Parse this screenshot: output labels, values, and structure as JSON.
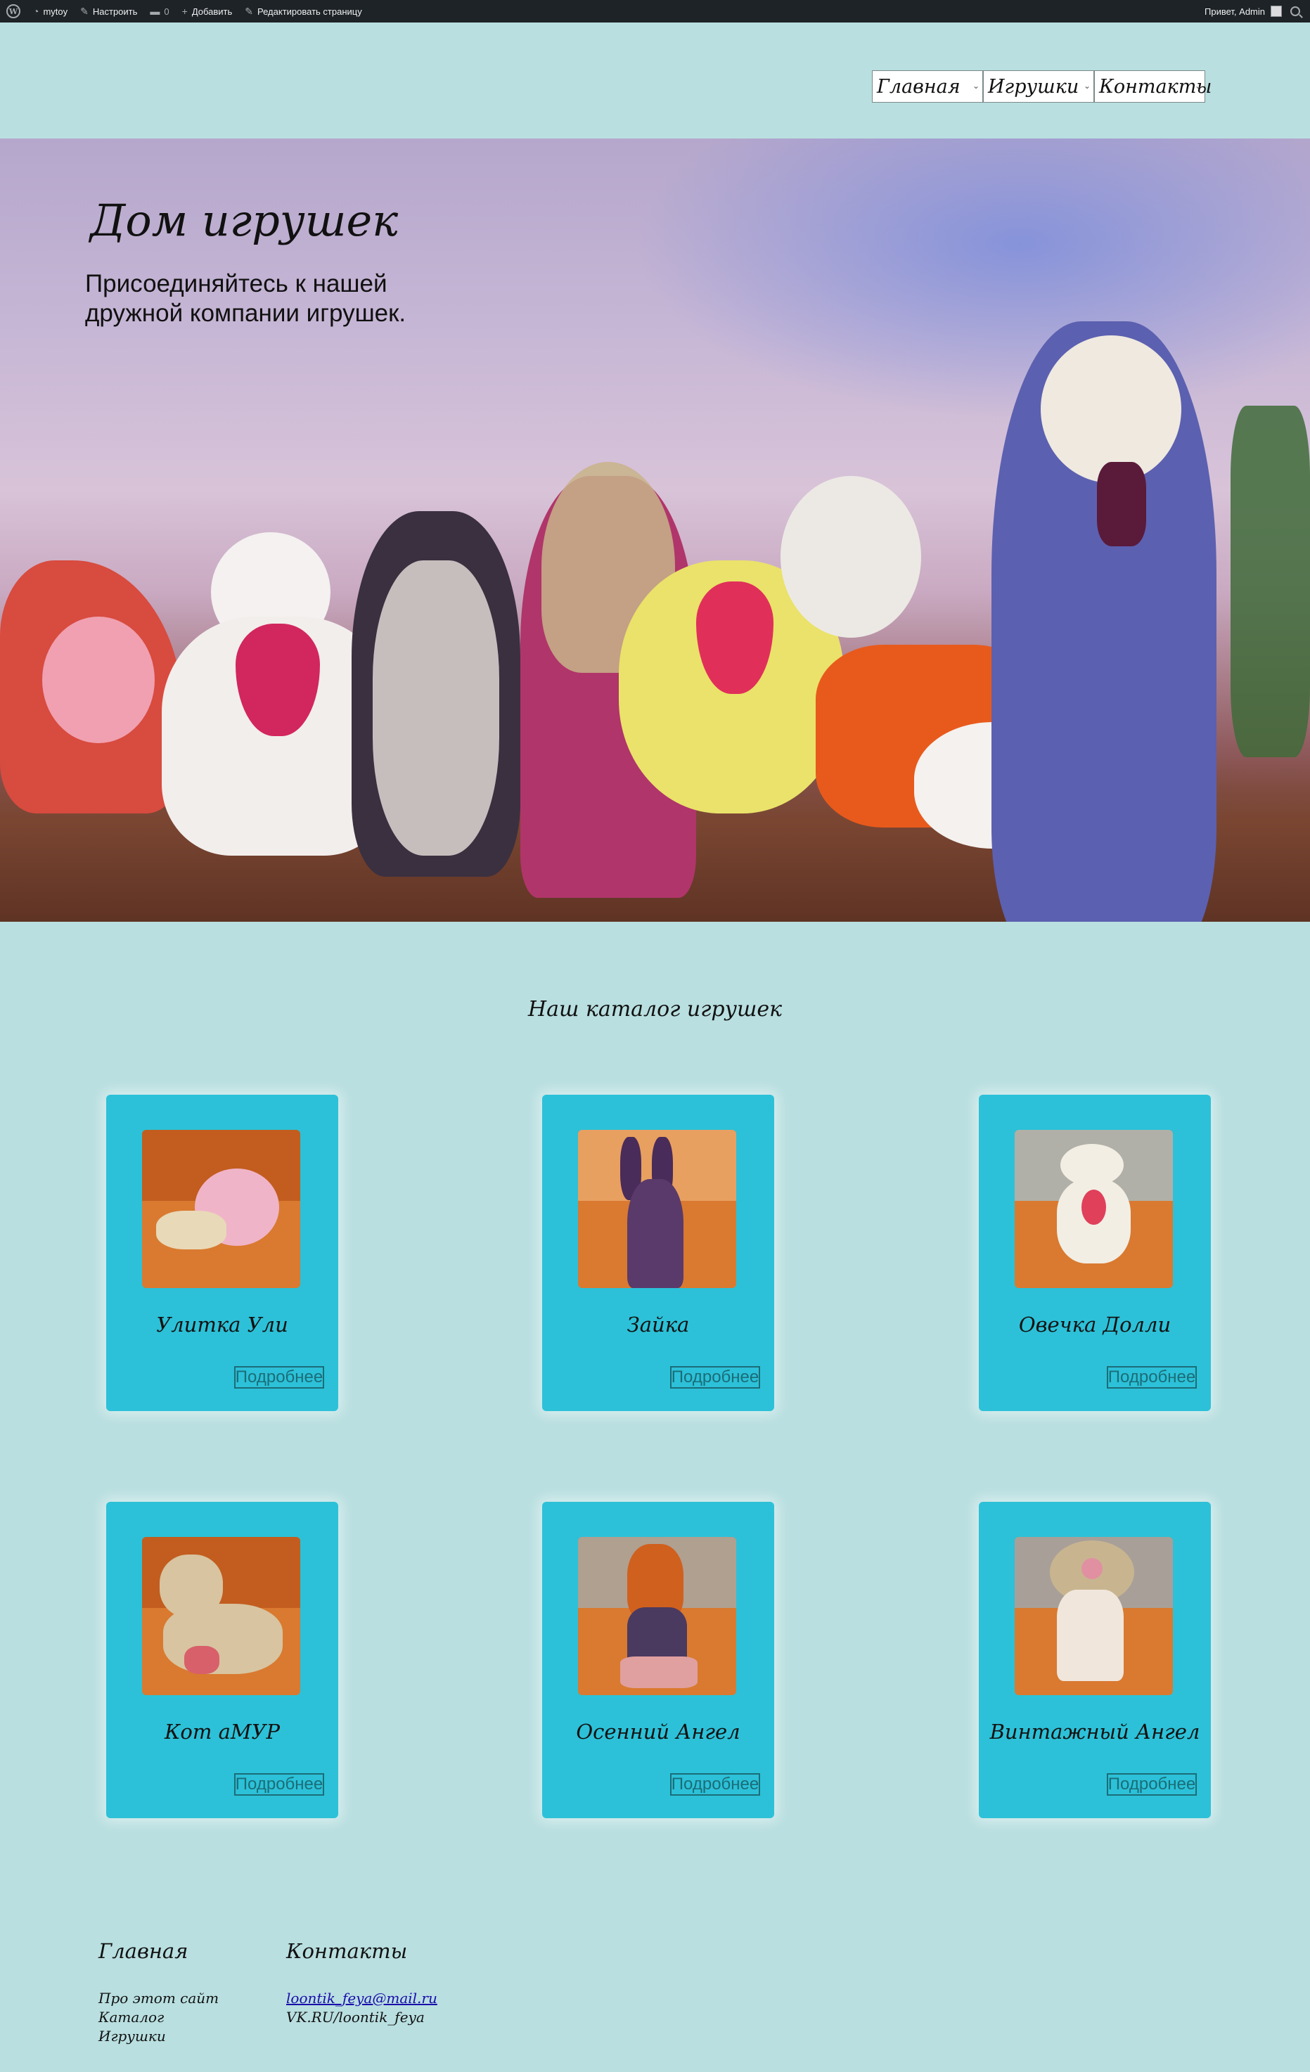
{
  "admin_bar": {
    "site_name": "mytoy",
    "customize": "Настроить",
    "comments_count": "0",
    "new": "Добавить",
    "edit_page": "Редактировать страницу",
    "greeting": "Привет, Admin"
  },
  "nav": {
    "items": [
      {
        "label": "Главная"
      },
      {
        "label": "Игрушки"
      },
      {
        "label": "Контакты"
      }
    ]
  },
  "hero": {
    "title": "Дом игрушек",
    "subtitle": "Присоединяйтесь к нашей дружной компании игрушек."
  },
  "catalog": {
    "title": "Наш каталог игрушек",
    "more_label": "Подробнее",
    "items": [
      {
        "name": "Улитка Ули"
      },
      {
        "name": "Зайка"
      },
      {
        "name": "Овечка Долли"
      },
      {
        "name": "Кот аМУР"
      },
      {
        "name": "Осенний Ангел"
      },
      {
        "name": "Винтажный Ангел"
      }
    ]
  },
  "footer": {
    "col1": {
      "heading": "Главная",
      "links": [
        "Про этот сайт",
        "Каталог",
        "Игрушки"
      ]
    },
    "col2": {
      "heading": "Контакты",
      "email": "loontik_feya@mail.ru",
      "vk": "VK.RU/loontik_feya"
    }
  },
  "colors": {
    "page_bg": "#b9dfe0",
    "card_bg": "#2cc1d8",
    "admin_bar_bg": "#1d2327"
  }
}
